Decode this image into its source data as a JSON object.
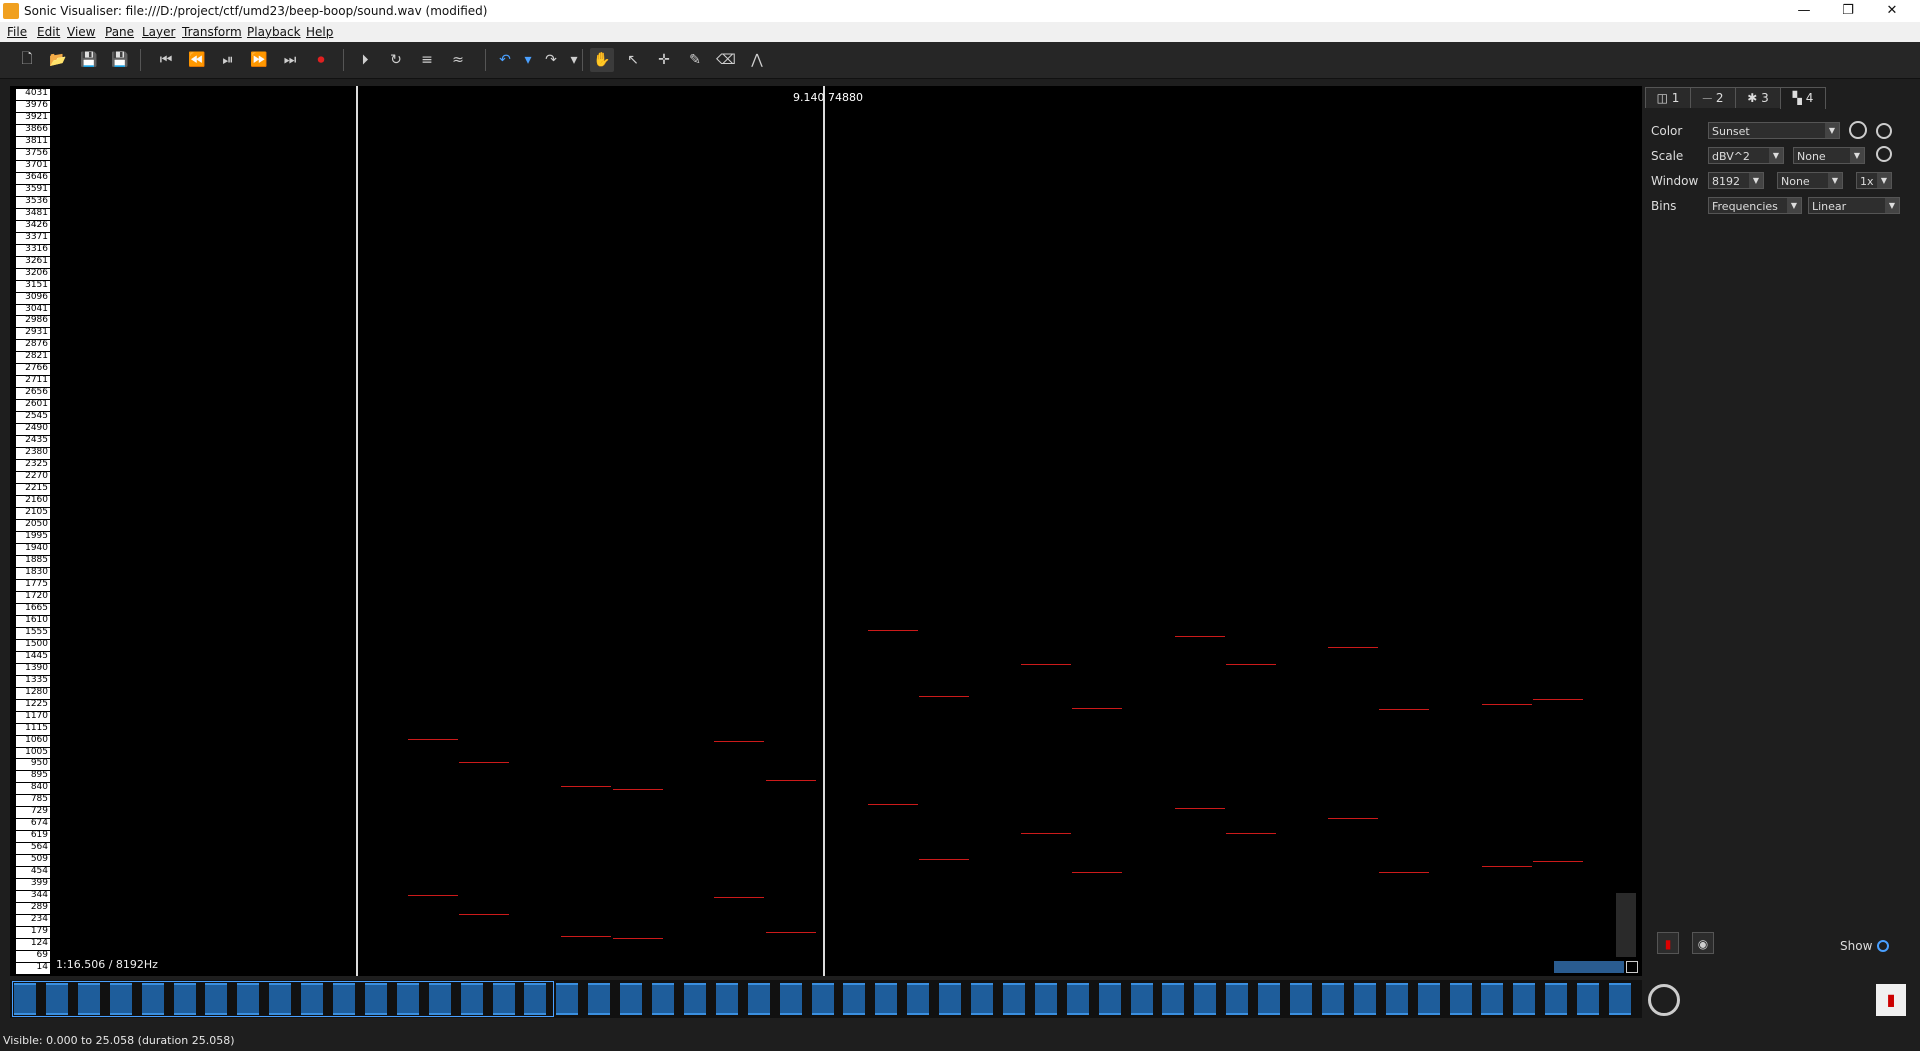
{
  "window": {
    "title": "Sonic Visualiser: file:///D:/project/ctf/umd23/beep-boop/sound.wav (modified)",
    "minimize": "—",
    "maximize": "❐",
    "close": "✕"
  },
  "menu": [
    "File",
    "Edit",
    "View",
    "Pane",
    "Layer",
    "Transform",
    "Playback",
    "Help"
  ],
  "toolbar": {
    "icons": [
      "new-icon",
      "open-icon",
      "save-icon",
      "save-as-icon",
      "rewind-start-icon",
      "rewind-icon",
      "play-pause-icon",
      "fast-forward-icon",
      "ffwd-end-icon",
      "record-icon",
      "play-selection-icon",
      "loop-icon",
      "solo-icon",
      "speed-icon",
      "undo-icon",
      "undo-menu-icon",
      "redo-icon",
      "redo-menu-icon",
      "navigate-icon",
      "select-icon",
      "edit-icon",
      "draw-icon",
      "erase-icon",
      "measure-icon"
    ],
    "glyphs": [
      "🗋",
      "📂",
      "💾",
      "💾",
      "⏮",
      "⏪",
      "⏯",
      "⏩",
      "⏭",
      "⏺",
      "⏵",
      "↻",
      "≡",
      "≈",
      "↶",
      "▾",
      "↷",
      "▾",
      "✋",
      "↖",
      "✛",
      "✎",
      "⌫",
      "⋀"
    ]
  },
  "ruler": {
    "labels": [
      "4031",
      "3976",
      "3921",
      "3866",
      "3811",
      "3756",
      "3701",
      "3646",
      "3591",
      "3536",
      "3481",
      "3426",
      "3371",
      "3316",
      "3261",
      "3206",
      "3151",
      "3096",
      "3041",
      "2986",
      "2931",
      "2876",
      "2821",
      "2766",
      "2711",
      "2656",
      "2601",
      "2545",
      "2490",
      "2435",
      "2380",
      "2325",
      "2270",
      "2215",
      "2160",
      "2105",
      "2050",
      "1995",
      "1940",
      "1885",
      "1830",
      "1775",
      "1720",
      "1665",
      "1610",
      "1555",
      "1500",
      "1445",
      "1390",
      "1335",
      "1280",
      "1225",
      "1170",
      "1115",
      "1060",
      "1005",
      "950",
      "895",
      "840",
      "785",
      "729",
      "674",
      "619",
      "564",
      "509",
      "454",
      "399",
      "344",
      "289",
      "234",
      "179",
      "124",
      "69",
      "14"
    ]
  },
  "view": {
    "cursor_time": "9.140",
    "cursor_frame": "74880",
    "bottom_info": "1:16.506 / 8192Hz"
  },
  "status": {
    "visible": "Visible: 0.000 to 25.058 (duration 25.058)"
  },
  "panel": {
    "tabs": [
      "1",
      "2",
      "3",
      "4"
    ],
    "tab_icons": [
      "pane-icon",
      "waveform-icon",
      "spectrum-icon",
      "spectrogram-icon"
    ],
    "color_label": "Color",
    "color_value": "Sunset",
    "scale_label": "Scale",
    "scale_value": "dBV^2",
    "scale_norm": "None",
    "window_label": "Window",
    "window_value": "8192",
    "window_norm": "None",
    "window_overlap": "1x",
    "bins_label": "Bins",
    "bins_value": "Frequencies",
    "bins_scale": "Linear",
    "show_label": "Show"
  },
  "colors": {
    "note": "#cc1a1a",
    "overview_block": "#1e5d9b",
    "overview_edge": "#3a8fe0"
  }
}
